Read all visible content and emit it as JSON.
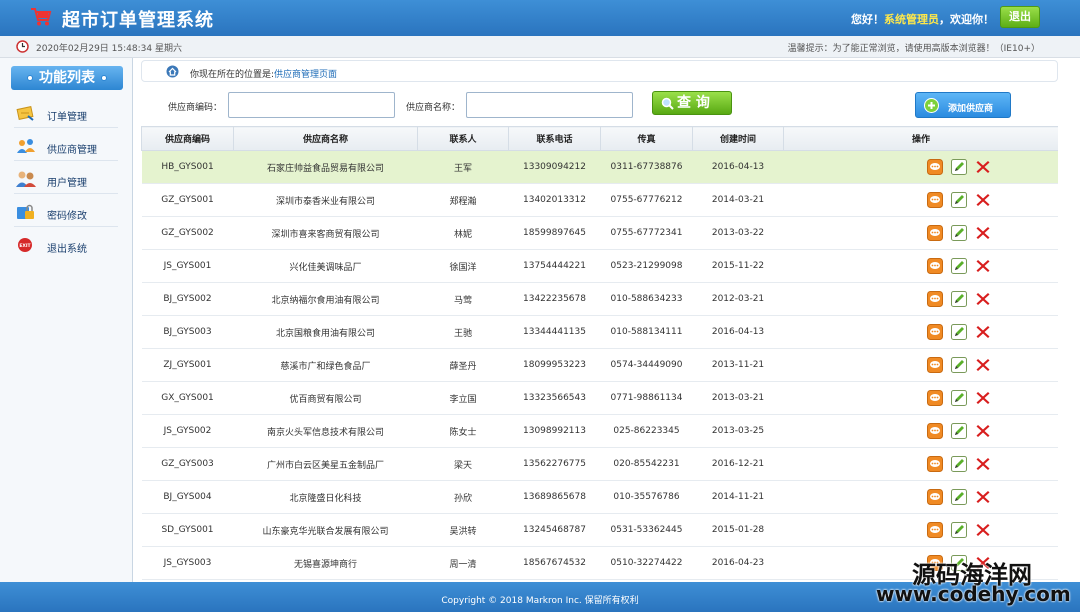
{
  "header": {
    "title": "超市订单管理系统",
    "welcome_prefix": "您好！",
    "user_name": "系统管理员",
    "welcome_suffix": "，欢迎你！",
    "logout_label": "退出"
  },
  "infobar": {
    "datetime": "2020年02月29日 15:48:34 星期六",
    "tip": "温馨提示：为了能正常浏览，请使用高版本浏览器！（IE10+）"
  },
  "sidebar": {
    "title": "功能列表",
    "items": [
      {
        "label": "订单管理",
        "icon": "order-icon"
      },
      {
        "label": "供应商管理",
        "icon": "supplier-icon"
      },
      {
        "label": "用户管理",
        "icon": "users-icon"
      },
      {
        "label": "密码修改",
        "icon": "password-icon"
      },
      {
        "label": "退出系统",
        "icon": "exit-icon"
      }
    ]
  },
  "breadcrumb": {
    "prefix": "你现在所在的位置是:",
    "current": "供应商管理页面"
  },
  "search": {
    "code_label": "供应商编码：",
    "code_value": "",
    "name_label": "供应商名称：",
    "name_value": "",
    "query_label": "查 询",
    "add_label": "添加供应商"
  },
  "table": {
    "headers": [
      "供应商编码",
      "供应商名称",
      "联系人",
      "联系电话",
      "传真",
      "创建时间",
      "操作"
    ],
    "rows": [
      [
        "HB_GYS001",
        "石家庄帅益食品贸易有限公司",
        "王军",
        "13309094212",
        "0311-67738876",
        "2016-04-13"
      ],
      [
        "GZ_GYS001",
        "深圳市泰香米业有限公司",
        "郑程瀚",
        "13402013312",
        "0755-67776212",
        "2014-03-21"
      ],
      [
        "GZ_GYS002",
        "深圳市喜来客商贸有限公司",
        "林妮",
        "18599897645",
        "0755-67772341",
        "2013-03-22"
      ],
      [
        "JS_GYS001",
        "兴化佳美调味品厂",
        "徐国洋",
        "13754444221",
        "0523-21299098",
        "2015-11-22"
      ],
      [
        "BJ_GYS002",
        "北京纳福尔食用油有限公司",
        "马莺",
        "13422235678",
        "010-588634233",
        "2012-03-21"
      ],
      [
        "BJ_GYS003",
        "北京国粮食用油有限公司",
        "王驰",
        "13344441135",
        "010-588134111",
        "2016-04-13"
      ],
      [
        "ZJ_GYS001",
        "慈溪市广和绿色食品厂",
        "薛圣丹",
        "18099953223",
        "0574-34449090",
        "2013-11-21"
      ],
      [
        "GX_GYS001",
        "优百商贸有限公司",
        "李立国",
        "13323566543",
        "0771-98861134",
        "2013-03-21"
      ],
      [
        "JS_GYS002",
        "南京火头军信息技术有限公司",
        "陈女士",
        "13098992113",
        "025-86223345",
        "2013-03-25"
      ],
      [
        "GZ_GYS003",
        "广州市白云区美星五金制品厂",
        "梁天",
        "13562276775",
        "020-85542231",
        "2016-12-21"
      ],
      [
        "BJ_GYS004",
        "北京隆盛日化科技",
        "孙欣",
        "13689865678",
        "010-35576786",
        "2014-11-21"
      ],
      [
        "SD_GYS001",
        "山东豪克华光联合发展有限公司",
        "吴洪转",
        "13245468787",
        "0531-53362445",
        "2015-01-28"
      ],
      [
        "JS_GYS003",
        "无锡喜源坤商行",
        "周一清",
        "18567674532",
        "0510-32274422",
        "2016-04-23"
      ]
    ]
  },
  "footer": {
    "copyright": "Copyright © 2018 Markron Inc. 保留所有权利"
  },
  "watermark": {
    "line1": "源码海洋网",
    "line2": "www.codehy.com"
  },
  "colors": {
    "brand_blue": "#2a74be",
    "accent_green": "#5dae16",
    "selected_row": "#e5f3cf"
  }
}
